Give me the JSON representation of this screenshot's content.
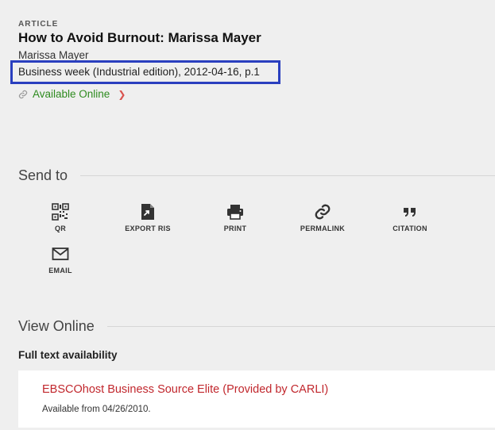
{
  "record": {
    "type": "ARTICLE",
    "title": "How to Avoid Burnout: Marissa Mayer",
    "author": "Marissa Mayer",
    "source": "Business week (Industrial edition), 2012-04-16, p.1",
    "availability": "Available Online"
  },
  "send_to": {
    "heading": "Send to",
    "actions": [
      {
        "label": "QR",
        "icon": "qr-code-icon"
      },
      {
        "label": "EXPORT RIS",
        "icon": "file-export-icon"
      },
      {
        "label": "PRINT",
        "icon": "printer-icon"
      },
      {
        "label": "PERMALINK",
        "icon": "link-icon"
      },
      {
        "label": "CITATION",
        "icon": "quote-icon"
      },
      {
        "label": "EMAIL",
        "icon": "envelope-icon"
      }
    ]
  },
  "view_online": {
    "heading": "View Online",
    "fulltext_label": "Full text availability",
    "provider": "EBSCOhost Business Source Elite (Provided by CARLI)",
    "available_from": "Available from 04/26/2010."
  },
  "colors": {
    "highlight_border": "#2a3fbf",
    "available_green": "#2e8b1f",
    "provider_red": "#c1272d"
  }
}
